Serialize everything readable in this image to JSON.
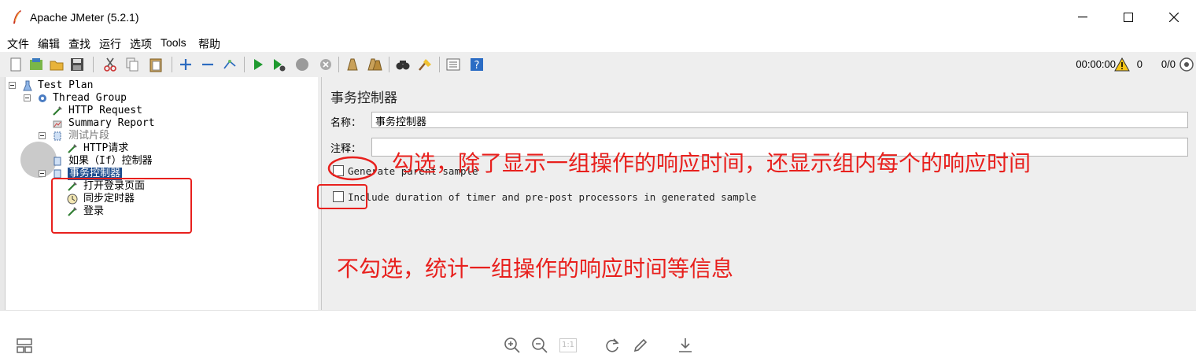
{
  "window": {
    "title": "Apache JMeter (5.2.1)",
    "minimize": "—",
    "maximize": "☐",
    "close": "✕"
  },
  "menu": [
    "文件",
    "编辑",
    "查找",
    "运行",
    "选项",
    "Tools",
    "帮助"
  ],
  "toolbar": {
    "icons": [
      "new-icon",
      "templates-icon",
      "open-icon",
      "save-icon",
      "cut-icon",
      "copy-icon",
      "paste-icon",
      "expand-icon",
      "collapse-icon",
      "toggle-icon",
      "start-icon",
      "start-no-pause-icon",
      "stop-icon",
      "shutdown-icon",
      "clear-icon",
      "clear-all-icon",
      "search-icon",
      "reset-search-icon",
      "function-helper-icon",
      "help-icon"
    ],
    "timer": "00:00:00",
    "warnings": "0",
    "threads": "0/0"
  },
  "tree": {
    "test_plan": "Test Plan",
    "thread_group": "Thread Group",
    "http_request": "HTTP Request",
    "summary_report": "Summary Report",
    "test_fragment": "测试片段",
    "http_cn": "HTTP请求",
    "if_controller": "如果（If）控制器",
    "transaction_controller": "事务控制器",
    "open_login_page": "打开登录页面",
    "sync_timer": "同步定时器",
    "login": "登录"
  },
  "editor": {
    "title": "事务控制器",
    "name_label": "名称：",
    "name_value": "事务控制器",
    "comment_label": "注释：",
    "comment_value": "",
    "generate_parent_label": "Generate parent sample",
    "generate_parent_checked": false,
    "include_duration_label": "Include duration of timer and pre-post processors in generated sample",
    "include_duration_checked": false
  },
  "annotations": {
    "checked_note": "勾选，除了显示一组操作的响应时间，还显示组内每个的响应时间",
    "unchecked_note": "不勾选，统计一组操作的响应时间等信息"
  },
  "colors": {
    "annotation_red": "#e8201d",
    "selection_blue": "#1f4e8f"
  },
  "viewer_toolbar": [
    "layout-icon",
    "zoom-in-icon",
    "zoom-out-icon",
    "actual-size-icon",
    "rotate-icon",
    "edit-icon",
    "download-icon"
  ],
  "actual_size_label": "1:1"
}
